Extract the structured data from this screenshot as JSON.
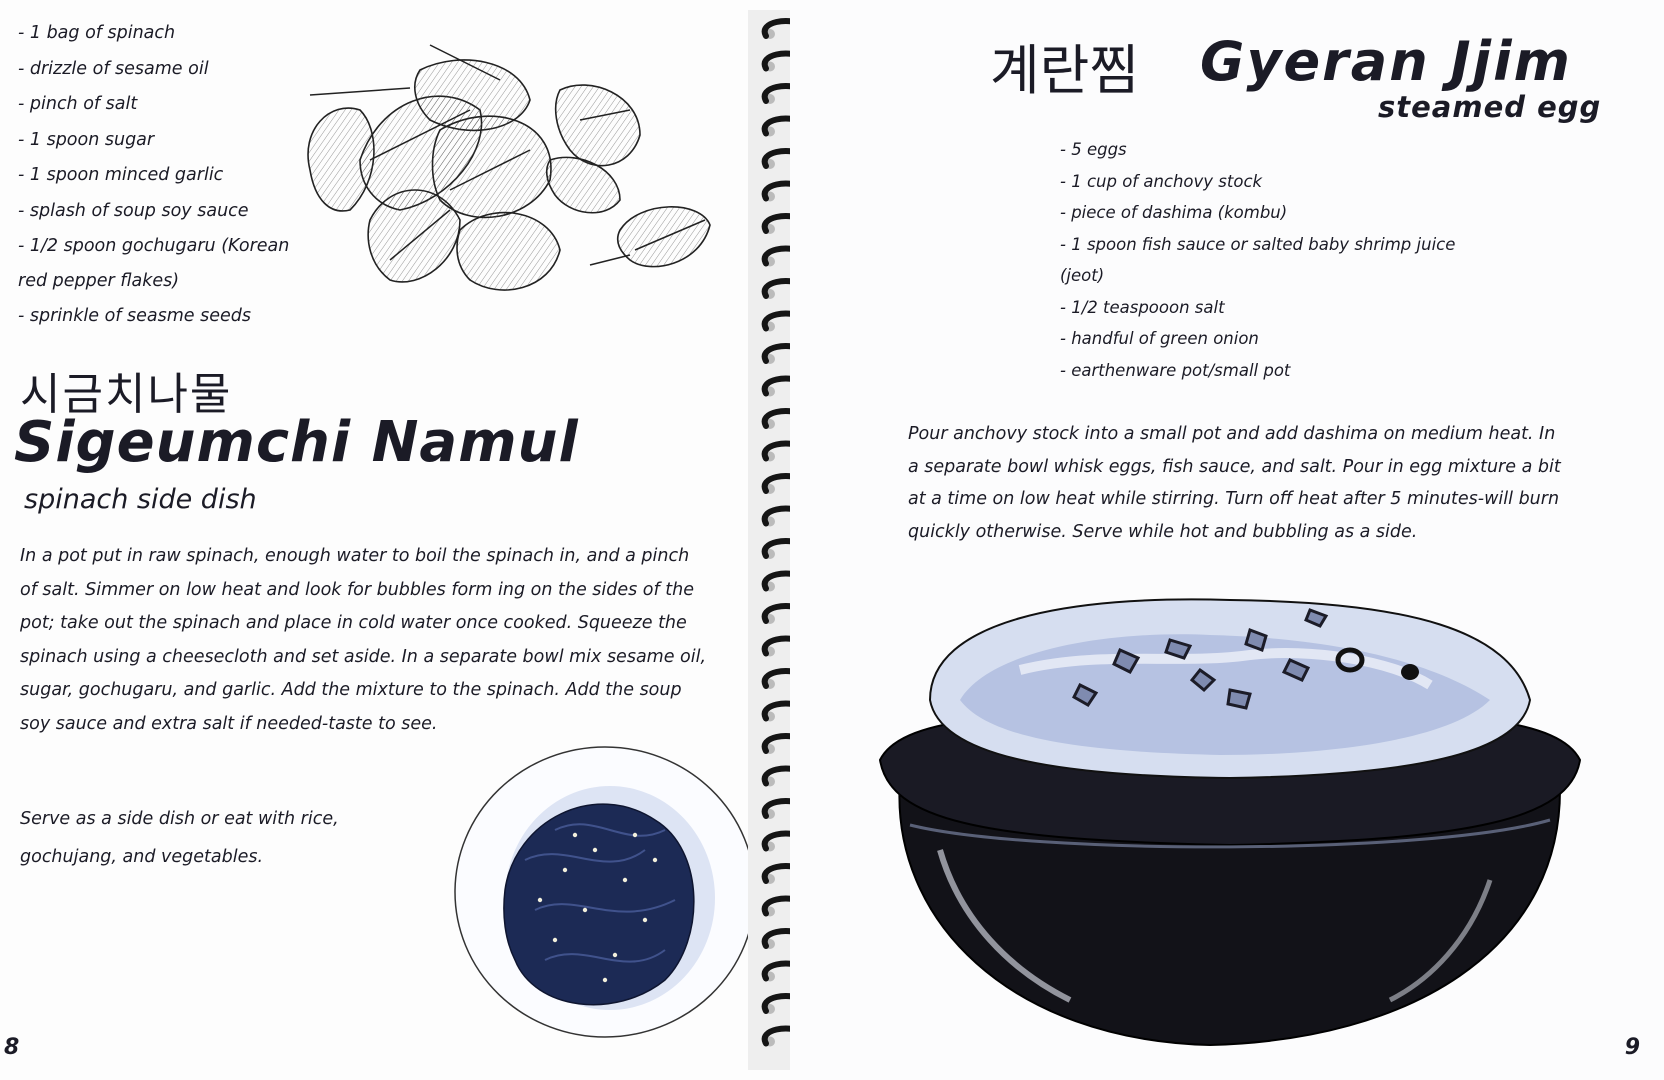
{
  "left_page": {
    "ingredients": [
      "- 1 bag of spinach",
      "- drizzle of sesame oil",
      "- pinch of salt",
      "- 1 spoon sugar",
      "- 1 spoon minced garlic",
      "- splash of soup soy sauce",
      "- 1/2 spoon gochugaru (Korean red pepper flakes)",
      "- sprinkle of seasme seeds"
    ],
    "korean_title": "시금치나물",
    "title": "Sigeumchi Namul",
    "subtitle": "spinach side dish",
    "body": "In a pot put in raw spinach, enough water to boil the spinach in, and a pinch of salt. Simmer on low heat and look for bubbles form ing on the sides of the pot; take out the spinach and place in cold water once cooked. Squeeze the spinach using a cheesecloth and set aside. In a separate bowl mix sesame oil, sugar, gochugaru, and garlic. Add the mixture to the spinach. Add the soup soy sauce and extra salt if needed-taste to see.",
    "serve": "Serve as a side dish or eat with rice, gochujang, and vegetables.",
    "page_number": "8"
  },
  "right_page": {
    "korean_title": "계란찜",
    "title": "Gyeran Jjim",
    "subtitle": "steamed egg",
    "ingredients": [
      "- 5 eggs",
      "- 1 cup of anchovy stock",
      "- piece of dashima (kombu)",
      "- 1 spoon fish sauce or salted baby shrimp juice (jeot)",
      "- 1/2 teaspooon salt",
      "- handful of green onion",
      "- earthenware pot/small pot"
    ],
    "body": "Pour anchovy stock into a small pot and add dashima on medium heat. In a separate bowl whisk eggs, fish sauce, and salt. Pour in egg mixture a bit at a time on low heat while stirring. Turn off heat after 5 minutes-will burn quickly otherwise. Serve while hot and bubbling as a side.",
    "page_number": "9"
  },
  "colors": {
    "ink": "#1b1b26",
    "wash_blue": "#9fb0d6",
    "wash_light": "#cdd7ee",
    "pot_dark": "#111118"
  }
}
